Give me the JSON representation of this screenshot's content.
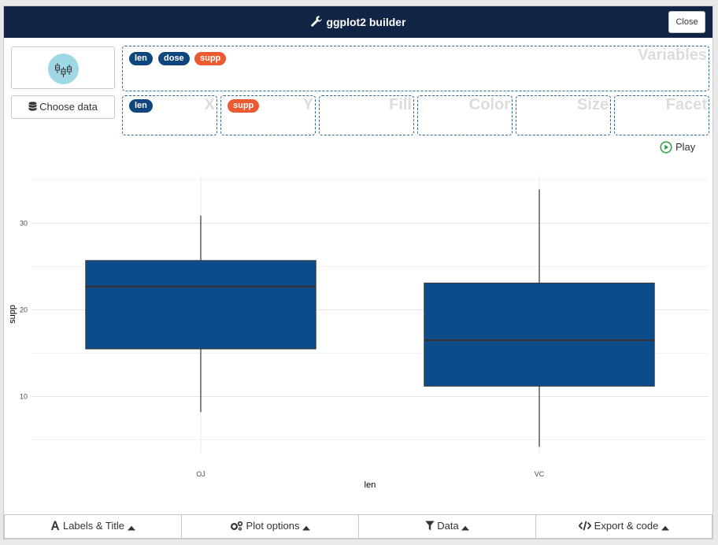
{
  "header": {
    "title": "ggplot2 builder",
    "close_label": "Close"
  },
  "sidebar": {
    "geom_icon": "boxplot-icon",
    "choose_data_label": "Choose data"
  },
  "variables": {
    "label": "Variables",
    "items": [
      {
        "name": "len",
        "color": "#10467e"
      },
      {
        "name": "dose",
        "color": "#10467e"
      },
      {
        "name": "supp",
        "color": "#ec5a32"
      }
    ]
  },
  "aesthetics": {
    "x": {
      "label": "X",
      "value": "len"
    },
    "y": {
      "label": "Y",
      "value": "supp"
    },
    "fill": {
      "label": "Fill",
      "value": ""
    },
    "color": {
      "label": "Color",
      "value": ""
    },
    "size": {
      "label": "Size",
      "value": ""
    },
    "facet": {
      "label": "Facet",
      "value": ""
    }
  },
  "play_label": "Play",
  "chart_data": {
    "type": "boxplot",
    "xlabel": "len",
    "ylabel": "supp",
    "categories": [
      "OJ",
      "VC"
    ],
    "yticks": [
      10,
      20,
      30
    ],
    "ylim": [
      3.5,
      35.5
    ],
    "fill": "#0d4c8a",
    "boxes": [
      {
        "name": "OJ",
        "min": 8.2,
        "q1": 15.5,
        "median": 22.7,
        "q3": 25.7,
        "max": 30.9
      },
      {
        "name": "VC",
        "min": 4.2,
        "q1": 11.2,
        "median": 16.5,
        "q3": 23.1,
        "max": 33.9
      }
    ],
    "grid": true
  },
  "footer": {
    "labels_title": "Labels & Title",
    "plot_options": "Plot options",
    "data": "Data",
    "export_code": "Export & code"
  }
}
